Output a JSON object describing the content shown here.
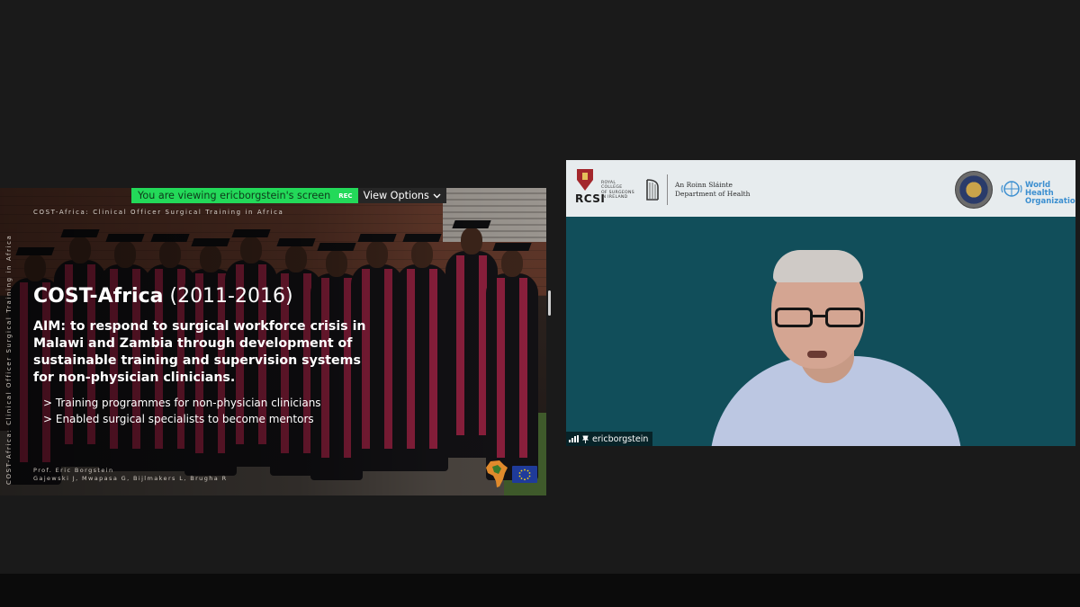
{
  "share_banner": {
    "viewing_text": "You are viewing ericborgstein's screen",
    "rec_label": "REC",
    "view_options_label": "View Options",
    "view_options_icon": "chevron-down-icon"
  },
  "slide": {
    "header": "COST-Africa: Clinical Officer Surgical Training in Africa",
    "side_text": "COST-Africa: Clinical Officer Surgical Training in Africa",
    "title_bold": "COST-Africa",
    "title_years": "(2011-2016)",
    "aim": "AIM: to respond to surgical workforce crisis in Malawi and Zambia through development of sustainable training and supervision systems for non-physician clinicians.",
    "bullets": [
      "> Training programmes for non-physician clinicians",
      "> Enabled surgical specialists to become mentors"
    ],
    "credit_author": "Prof. Eric Borgstein",
    "credit_coauthors": "Gajewski J, Mwapasa G, Bijlmakers L, Brugha R",
    "logos": [
      "africa-map-icon",
      "eu-flag-icon"
    ]
  },
  "video": {
    "participant_name": "ericborgstein",
    "banner": {
      "rcsi_abbrev": "RCSI",
      "rcsi_full": [
        "ROYAL",
        "COLLEGE",
        "OF SURGEONS",
        "IN IRELAND"
      ],
      "dept_irish": "An Roinn Sláinte",
      "dept_english": "Department of Health",
      "who_line1": "World Health",
      "who_line2": "Organization"
    }
  },
  "colors": {
    "share_green": "#23d959",
    "video_bg": "#114e5a",
    "who_blue": "#3c8fd0",
    "sash": "#8a1f3c"
  }
}
